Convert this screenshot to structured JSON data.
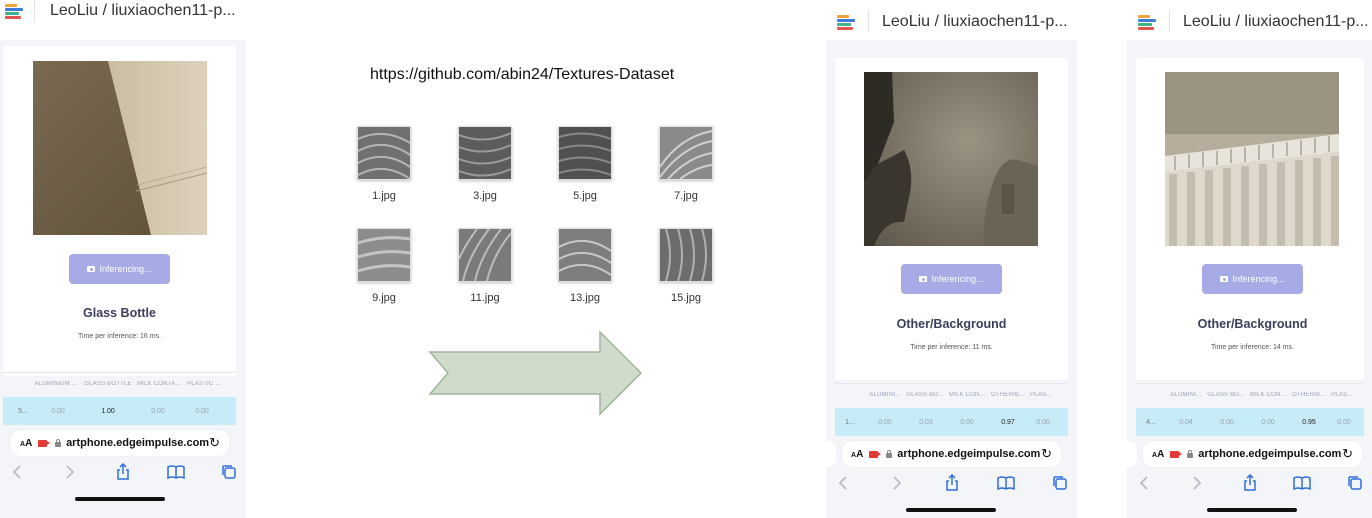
{
  "panels": [
    {
      "title": "LeoLiu / liuxiaochen11-p...",
      "button": "Inferencing...",
      "label": "Glass Bottle",
      "time": "Time per inference: 16 ms.",
      "headers": [
        "ALUMINIUM ...",
        "GLASS BOTTLE",
        "MILK CONTA...",
        "PLASTIC ..."
      ],
      "row": [
        "5...",
        "0.00",
        "1.00",
        "0.00",
        "0.00"
      ],
      "url": "artphone.edgeimpulse.com"
    },
    {
      "title": "LeoLiu / liuxiaochen11-p...",
      "button": "Inferencing...",
      "label": "Other/Background",
      "time": "Time per inference: 11 ms.",
      "headers": [
        "ALUMINI...",
        "GLASS BO...",
        "MILK CON...",
        "OTHER/B...",
        "PLAS..."
      ],
      "row": [
        "1...",
        "0.00",
        "0.03",
        "0.00",
        "0.97",
        "0.00"
      ],
      "url": "artphone.edgeimpulse.com"
    },
    {
      "title": "LeoLiu / liuxiaochen11-p...",
      "button": "Inferencing...",
      "label": "Other/Background",
      "time": "Time per inference: 14 ms.",
      "headers": [
        "ALUMINI...",
        "GLASS BO...",
        "MILK CON...",
        "OTHER/B...",
        "PLAS..."
      ],
      "row": [
        "4...",
        "0.04",
        "0.00",
        "0.00",
        "0.95",
        "0.00"
      ],
      "url": "artphone.edgeimpulse.com"
    }
  ],
  "urlbar": {
    "aa_big": "A",
    "aa_small": "A",
    "reload_icon": "↻"
  },
  "dataset": {
    "source": "https://github.com/abin24/Textures-Dataset",
    "thumbs": [
      "1.jpg",
      "3.jpg",
      "5.jpg",
      "7.jpg",
      "9.jpg",
      "11.jpg",
      "13.jpg",
      "15.jpg"
    ]
  },
  "icons": {
    "back": "chevron-left-icon",
    "forward": "chevron-right-icon",
    "share": "share-icon",
    "bookmarks": "book-icon",
    "tabs": "tabs-icon"
  },
  "colors": {
    "button": "#a6abe6",
    "table_row": "#c7ecf7",
    "arrow_fill": "#cfdccb",
    "arrow_stroke": "#9fb59a"
  }
}
